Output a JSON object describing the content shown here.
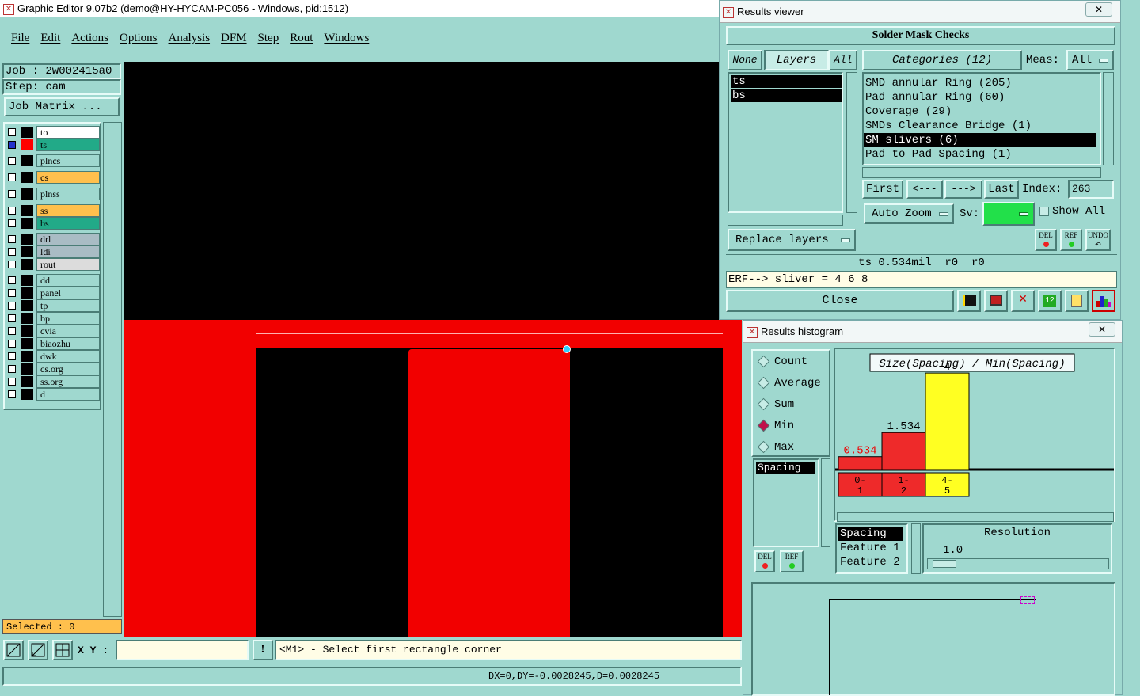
{
  "main_window": {
    "title": "Graphic Editor 9.07b2 (demo@HY-HYCAM-PC056 - Windows, pid:1512)",
    "menu": [
      "File",
      "Edit",
      "Actions",
      "Options",
      "Analysis",
      "DFM",
      "Step",
      "Rout",
      "Windows"
    ]
  },
  "job": {
    "job_label": "Job : 2w002415a0",
    "step_label": "Step: cam",
    "matrix_button": "Job Matrix ..."
  },
  "layers": [
    {
      "name": "to",
      "color": "#ffffff"
    },
    {
      "name": "ts",
      "color": "#22aa88"
    },
    {
      "name": "plncs",
      "color": "#9fd8cf"
    },
    {
      "name": "cs",
      "color": "#ffc04d"
    },
    {
      "name": "plnss",
      "color": "#9fd8cf"
    },
    {
      "name": "ss",
      "color": "#ffc04d"
    },
    {
      "name": "bs",
      "color": "#22aa88"
    },
    {
      "name": "drl",
      "color": "#a9bcc4"
    },
    {
      "name": "ldi",
      "color": "#a9bcc4"
    },
    {
      "name": "rout",
      "color": "#dcdcdc"
    },
    {
      "name": "dd",
      "color": "#9fd8cf"
    },
    {
      "name": "panel",
      "color": "#9fd8cf"
    },
    {
      "name": "tp",
      "color": "#9fd8cf"
    },
    {
      "name": "bp",
      "color": "#9fd8cf"
    },
    {
      "name": "cvia",
      "color": "#9fd8cf"
    },
    {
      "name": "biaozhu",
      "color": "#9fd8cf"
    },
    {
      "name": "dwk",
      "color": "#9fd8cf"
    },
    {
      "name": "cs.org",
      "color": "#9fd8cf"
    },
    {
      "name": "ss.org",
      "color": "#9fd8cf"
    },
    {
      "name": "d",
      "color": "#9fd8cf"
    }
  ],
  "selected_label": "Selected : 0",
  "bottom": {
    "xy_label": "X Y :",
    "xy_value": "",
    "prompt": "<M1> - Select first rectangle corner",
    "status": "DX=0,DY=-0.0028245,D=0.0028245"
  },
  "results_viewer": {
    "title": "Results viewer",
    "close_x": "✕",
    "header": "Solder Mask Checks",
    "none_btn": "None",
    "layers_btn": "Layers",
    "all_btn": "All",
    "categories_btn": "Categories (12)",
    "meas_label": "Meas:",
    "meas_value": "All",
    "layer_list": [
      "ts",
      "bs"
    ],
    "categories": [
      "SMD annular Ring (205)",
      "Pad annular Ring (60)",
      "Coverage (29)",
      "SMDs Clearance Bridge (1)",
      "SM slivers (6)",
      "Pad to Pad Spacing (1)"
    ],
    "nav": {
      "first": "First",
      "prev": "<---",
      "next": "--->",
      "last": "Last",
      "index_label": "Index:",
      "index_value": "263"
    },
    "auto_zoom": "Auto Zoom",
    "sv_label": "Sv:",
    "show_all": "Show All",
    "replace_layers": "Replace layers",
    "del_btn": "DEL",
    "ref_btn": "REF",
    "undo_btn": "UNDO",
    "result_line": "ts 0.534mil  r0  r0",
    "erf_line": "ERF--> sliver = 4 6 8",
    "close_btn": "Close"
  },
  "histogram": {
    "title": "Results histogram",
    "close_x": "✕",
    "radios": [
      "Count",
      "Average",
      "Sum",
      "Min",
      "Max"
    ],
    "selected_radio": "Min",
    "measure_list": [
      "Spacing"
    ],
    "del_btn": "DEL",
    "ref_btn": "REF",
    "field_list": [
      "Spacing",
      "Feature 1",
      "Feature 2"
    ],
    "resolution_label": "Resolution",
    "resolution_value": "1.0"
  },
  "chart_data": {
    "type": "bar",
    "title": "Size(Spacing) / Min(Spacing)",
    "categories": [
      "0-\n1",
      "1-\n2",
      "4-\n5"
    ],
    "category_labels": [
      [
        "0-",
        "1"
      ],
      [
        "1-",
        "2"
      ],
      [
        "4-",
        "5"
      ]
    ],
    "values": [
      0.534,
      1.534,
      4
    ],
    "value_labels": [
      "0.534",
      "1.534",
      "4"
    ],
    "colors": [
      "#ee2a2a",
      "#ee2a2a",
      "#ffff22"
    ],
    "label_colors": [
      "#ee0000",
      "#000000",
      "#000000"
    ],
    "ylim": [
      0,
      4.2
    ],
    "grid": false
  }
}
